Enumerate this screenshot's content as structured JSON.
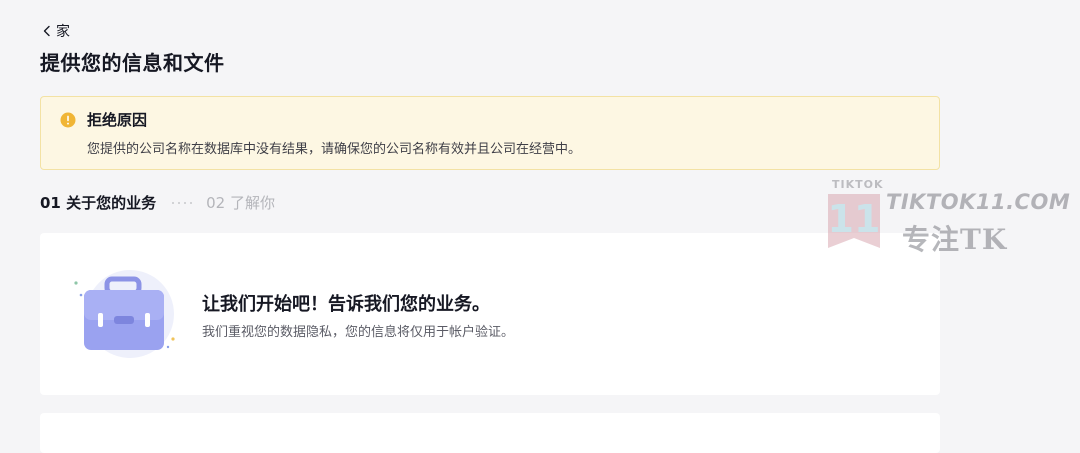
{
  "nav": {
    "back_label": "家"
  },
  "page": {
    "title": "提供您的信息和文件"
  },
  "alert": {
    "title": "拒绝原因",
    "message": "您提供的公司名称在数据库中没有结果，请确保您的公司名称有效并且公司在经营中。",
    "icon": "warning-dot-icon",
    "accent_color": "#f0b535"
  },
  "steps": [
    {
      "label": "01 关于您的业务",
      "active": true
    },
    {
      "label": "02 了解你",
      "active": false
    }
  ],
  "intro_card": {
    "heading": "让我们开始吧！告诉我们您的业务。",
    "subtext": "我们重视您的数据隐私，您的信息将仅用于帐户验证。",
    "icon": "briefcase-icon"
  },
  "watermark": {
    "top_text": "TIKTOK",
    "badge_text": "11",
    "domain": "TIKTOK11.COM",
    "sub": "专注TK"
  }
}
